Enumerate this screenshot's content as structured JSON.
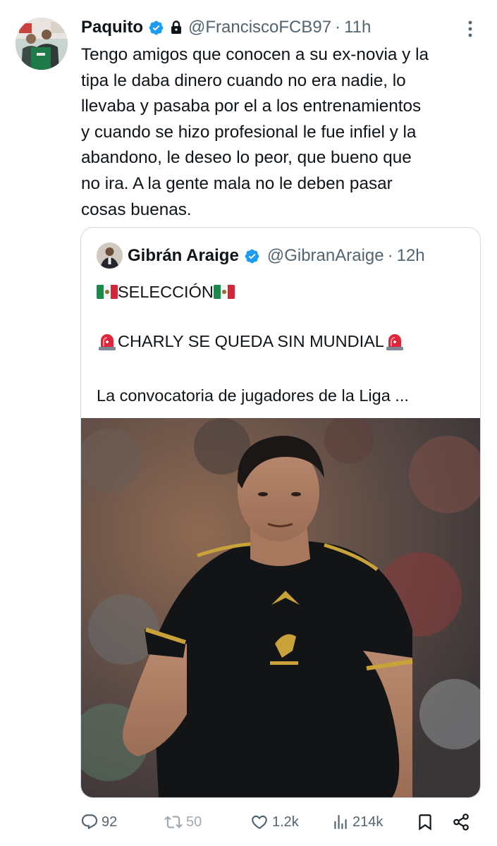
{
  "tweet": {
    "author": {
      "display_name": "Paquito",
      "handle": "@FranciscoFCB97",
      "time": "11h",
      "verified": true,
      "protected": true
    },
    "separator": "·",
    "text": "Tengo amigos que conocen a su ex-novia y la tipa le daba dinero cuando no era nadie, lo llevaba y pasaba por el a los entrenamientos y cuando se hizo profesional le fue infiel y la abandono, le deseo lo peor, que bueno que no ira. A la gente mala no le deben pasar cosas buenas.",
    "text_lines": [
      "Tengo amigos que conocen a su ex-novia y la",
      "tipa le daba dinero cuando no era nadie, lo",
      "llevaba y pasaba por el a los entrenamientos",
      "y cuando se hizo profesional le fue infiel y la",
      "abandono, le deseo lo peor, que bueno que",
      "no ira. A la gente mala no le deben pasar",
      "cosas buenas."
    ]
  },
  "quote": {
    "author": {
      "display_name": "Gibrán Araige",
      "handle": "@GibranAraige",
      "time": "12h",
      "verified": true
    },
    "separator": "·",
    "line1": "SELECCIÓN",
    "line2": "CHARLY SE QUEDA SIN MUNDIAL",
    "line3": "La convocatoria de jugadores de la Liga ...",
    "photo_alt": "Player in black México jersey"
  },
  "actions": {
    "replies": "92",
    "reposts": "50",
    "likes": "1.2k",
    "views": "214k"
  },
  "colors": {
    "text": "#0f1419",
    "secondary": "#536471",
    "verified_blue": "#1d9bf0",
    "border": "#cfd9de"
  },
  "icons": [
    "verified-badge-icon",
    "lock-icon",
    "more-icon",
    "reply-icon",
    "repost-icon",
    "like-icon",
    "views-icon",
    "bookmark-icon",
    "share-icon",
    "mexico-flag-icon",
    "siren-icon"
  ]
}
